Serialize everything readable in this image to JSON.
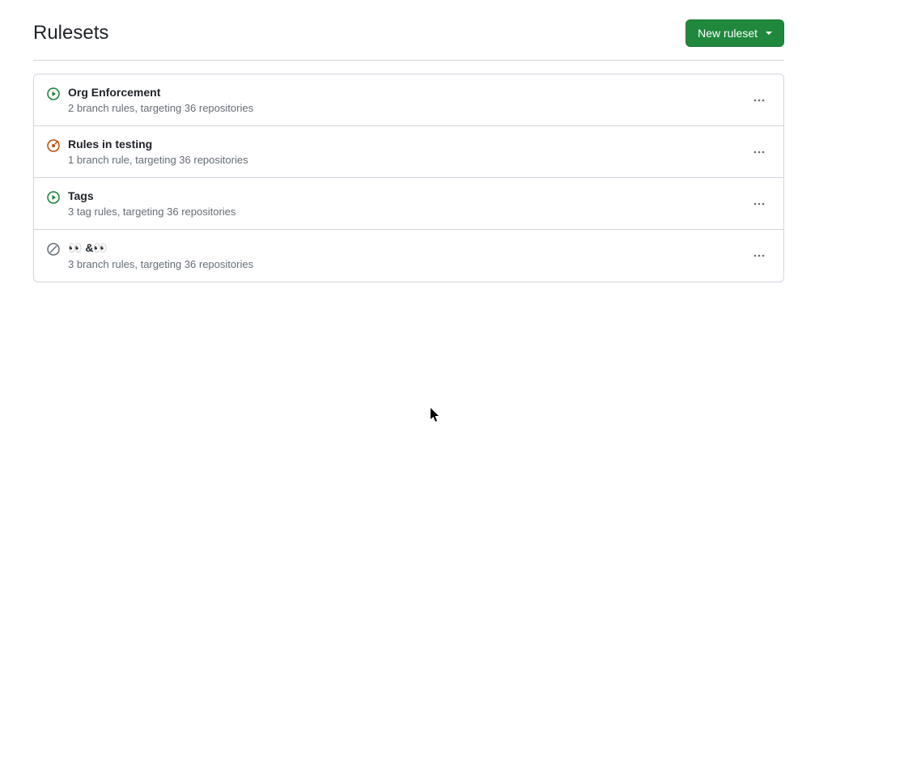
{
  "header": {
    "title": "Rulesets",
    "new_button_label": "New ruleset"
  },
  "rulesets": [
    {
      "icon": "play-active",
      "name": "Org Enforcement",
      "subtitle": "2 branch rules, targeting 36 repositories"
    },
    {
      "icon": "goal-testing",
      "name": "Rules in testing",
      "subtitle": "1 branch rule, targeting 36 repositories"
    },
    {
      "icon": "play-active",
      "name": "Tags",
      "subtitle": "3 tag rules, targeting 36 repositories"
    },
    {
      "icon": "skip-disabled",
      "name": "👀 &👀",
      "subtitle": "3 branch rules, targeting 36 repositories"
    }
  ]
}
